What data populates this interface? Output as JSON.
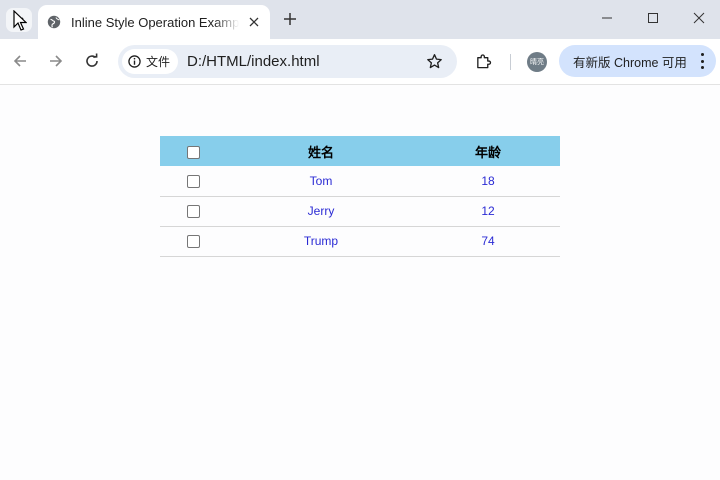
{
  "browser": {
    "tab": {
      "title": "Inline Style Operation Example"
    },
    "omnibox": {
      "site_chip": "文件",
      "url": "D:/HTML/index.html"
    },
    "profile": {
      "label": "晴亮"
    },
    "update_button": {
      "label": "有新版 Chrome 可用"
    }
  },
  "table": {
    "headers": {
      "name": "姓名",
      "age": "年龄"
    },
    "rows": [
      {
        "name": "Tom",
        "age": "18",
        "checked": false
      },
      {
        "name": "Jerry",
        "age": "12",
        "checked": false
      },
      {
        "name": "Trump",
        "age": "74",
        "checked": false
      }
    ]
  },
  "colors": {
    "header_bg": "#87ceeb",
    "cell_text": "#2a2ad4",
    "tabstrip_bg": "#dfe3eb",
    "update_button_bg": "#d3e3fd"
  }
}
